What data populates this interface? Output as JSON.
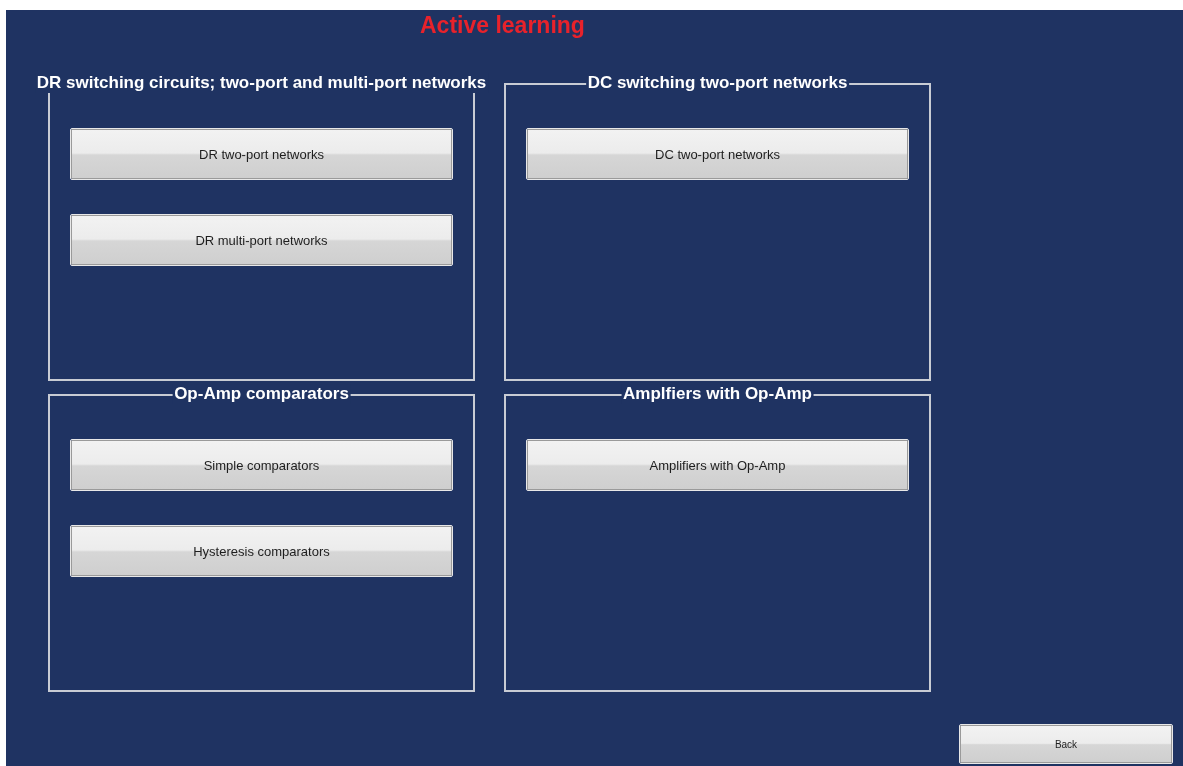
{
  "title": "Active learning",
  "panels": [
    {
      "title": "DR switching circuits; two-port and multi-port networks",
      "buttons": [
        "DR two-port networks",
        "DR multi-port networks"
      ]
    },
    {
      "title": "DC switching two-port networks",
      "buttons": [
        "DC two-port networks"
      ]
    },
    {
      "title": "Op-Amp comparators",
      "buttons": [
        "Simple comparators",
        "Hysteresis comparators"
      ]
    },
    {
      "title": "Amplfiers with Op-Amp",
      "buttons": [
        "Amplifiers with Op-Amp"
      ]
    }
  ],
  "back_button": "Back"
}
